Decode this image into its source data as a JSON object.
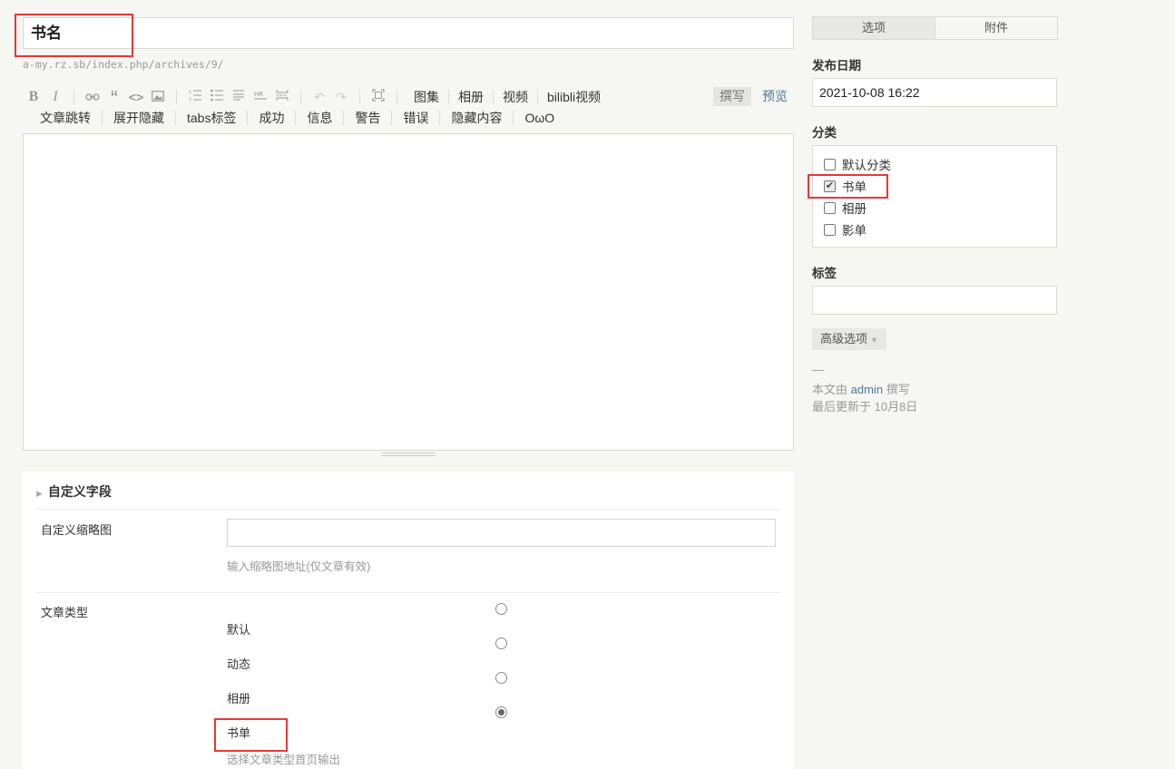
{
  "title": {
    "value": "书名"
  },
  "permalink": "a-my.rz.sb/index.php/archives/9/",
  "toolbar": {
    "icons": [
      "bold-icon",
      "italic-icon",
      "link-icon",
      "quote-icon",
      "code-icon",
      "image-icon",
      "ordered-list-icon",
      "unordered-list-icon",
      "title-icon",
      "hr-icon",
      "more-icon",
      "undo-icon",
      "redo-icon",
      "fullscreen-icon"
    ],
    "row1_buttons": [
      "图集",
      "相册",
      "视频",
      "bilibli视频"
    ],
    "row2_buttons": [
      "文章跳转",
      "展开隐藏",
      "tabs标签",
      "成功",
      "信息",
      "警告",
      "错误",
      "隐藏内容",
      "OωO"
    ],
    "write_tab": "撰写",
    "preview_tab": "预览"
  },
  "custom_fields": {
    "heading": "自定义字段",
    "thumbnail": {
      "label": "自定义缩略图",
      "value": "",
      "hint": "输入缩略图地址(仅文章有效)"
    },
    "post_type": {
      "label": "文章类型",
      "options": [
        "默认",
        "动态",
        "相册",
        "书单"
      ],
      "selected": "书单",
      "hint": "选择文章类型首页输出"
    }
  },
  "sidebar": {
    "tabs": [
      "选项",
      "附件"
    ],
    "active_tab": "选项",
    "publish_date": {
      "label": "发布日期",
      "value": "2021-10-08 16:22"
    },
    "categories": {
      "label": "分类",
      "items": [
        {
          "label": "默认分类",
          "checked": false
        },
        {
          "label": "书单",
          "checked": true
        },
        {
          "label": "相册",
          "checked": false
        },
        {
          "label": "影单",
          "checked": false
        }
      ]
    },
    "tags": {
      "label": "标签",
      "value": ""
    },
    "advanced": "高级选项",
    "meta": {
      "dash": "—",
      "author_prefix": "本文由",
      "author": "admin",
      "author_suffix": "撰写",
      "updated": "最后更新于 10月8日"
    }
  },
  "colors": {
    "background": "#f6f6f3",
    "link": "#467b96",
    "highlight": "#e53935"
  }
}
